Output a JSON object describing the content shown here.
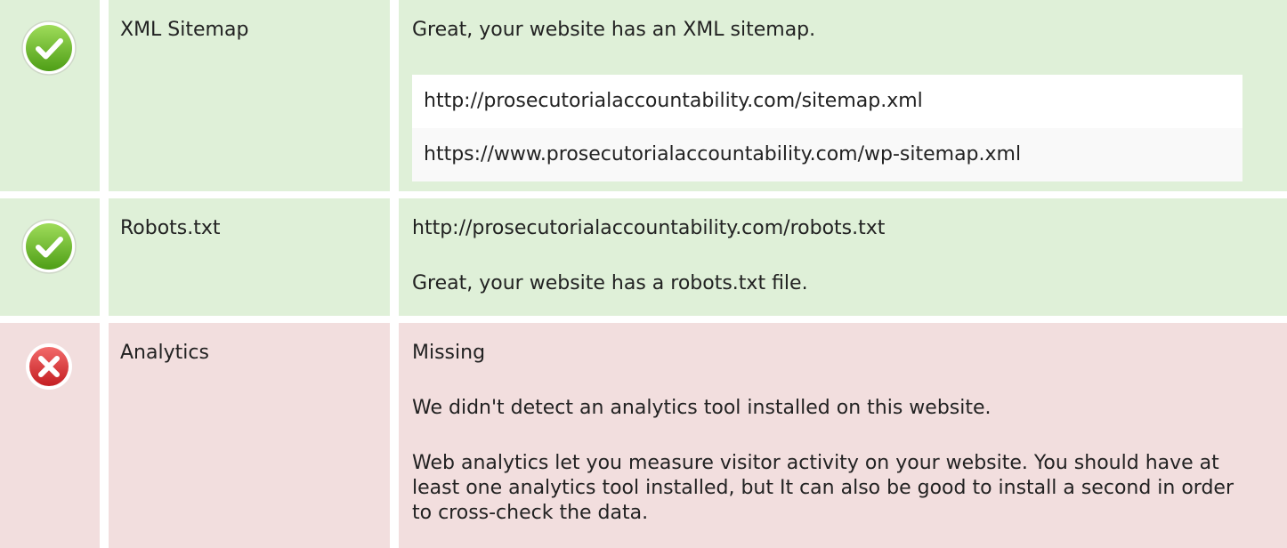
{
  "colors": {
    "pass_background": "#dff0d8",
    "fail_background": "#f2dede",
    "pass_icon": "#6cbc2a",
    "fail_icon": "#d9363a"
  },
  "rows": [
    {
      "status": "pass",
      "icon": "check-circle-icon",
      "label": "XML Sitemap",
      "message": "Great, your website has an XML sitemap.",
      "urls": [
        "http://prosecutorialaccountability.com/sitemap.xml",
        "https://www.prosecutorialaccountability.com/wp-sitemap.xml"
      ]
    },
    {
      "status": "pass",
      "icon": "check-circle-icon",
      "label": "Robots.txt",
      "url": "http://prosecutorialaccountability.com/robots.txt",
      "message": "Great, your website has a robots.txt file."
    },
    {
      "status": "fail",
      "icon": "error-circle-icon",
      "label": "Analytics",
      "value": "Missing",
      "message": "We didn't detect an analytics tool installed on this website.",
      "description": "Web analytics let you measure visitor activity on your website. You should have at least one analytics tool installed, but It can also be good to install a second in order to cross-check the data."
    }
  ]
}
